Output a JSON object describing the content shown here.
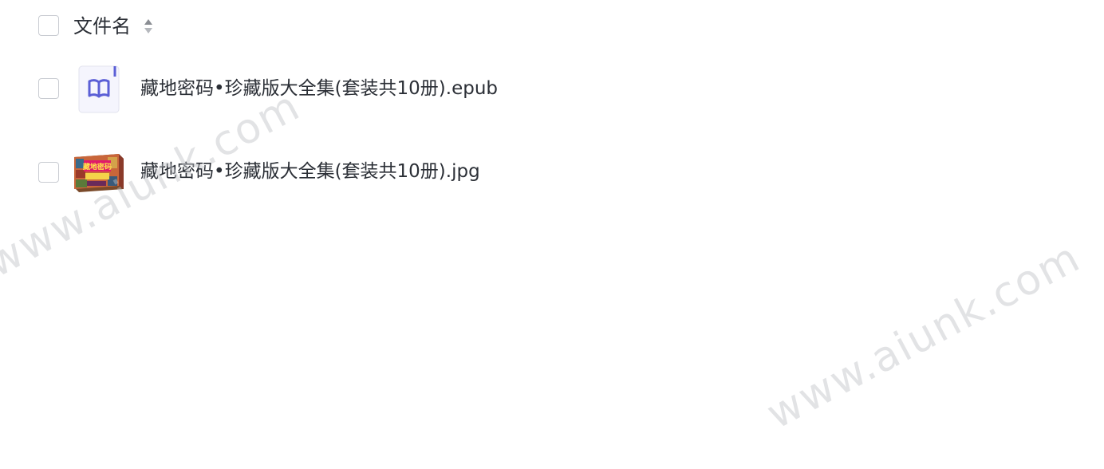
{
  "header": {
    "column_label": "文件名",
    "sort_icon": "sort-updown-icon"
  },
  "files": [
    {
      "name": "藏地密码•珍藏版大全集(套装共10册).epub",
      "icon": "epub-book-icon",
      "thumb_text": ""
    },
    {
      "name": "藏地密码•珍藏版大全集(套装共10册).jpg",
      "icon": "image-thumbnail",
      "thumb_text": "藏地密码"
    }
  ],
  "watermarks": [
    "www.aiunk.com",
    "www.aiunk.com"
  ],
  "colors": {
    "text": "#2b2f36",
    "checkbox_border": "#c9ccd2",
    "epub_accent": "#5b5fd6",
    "watermark": "#bec0c5"
  }
}
